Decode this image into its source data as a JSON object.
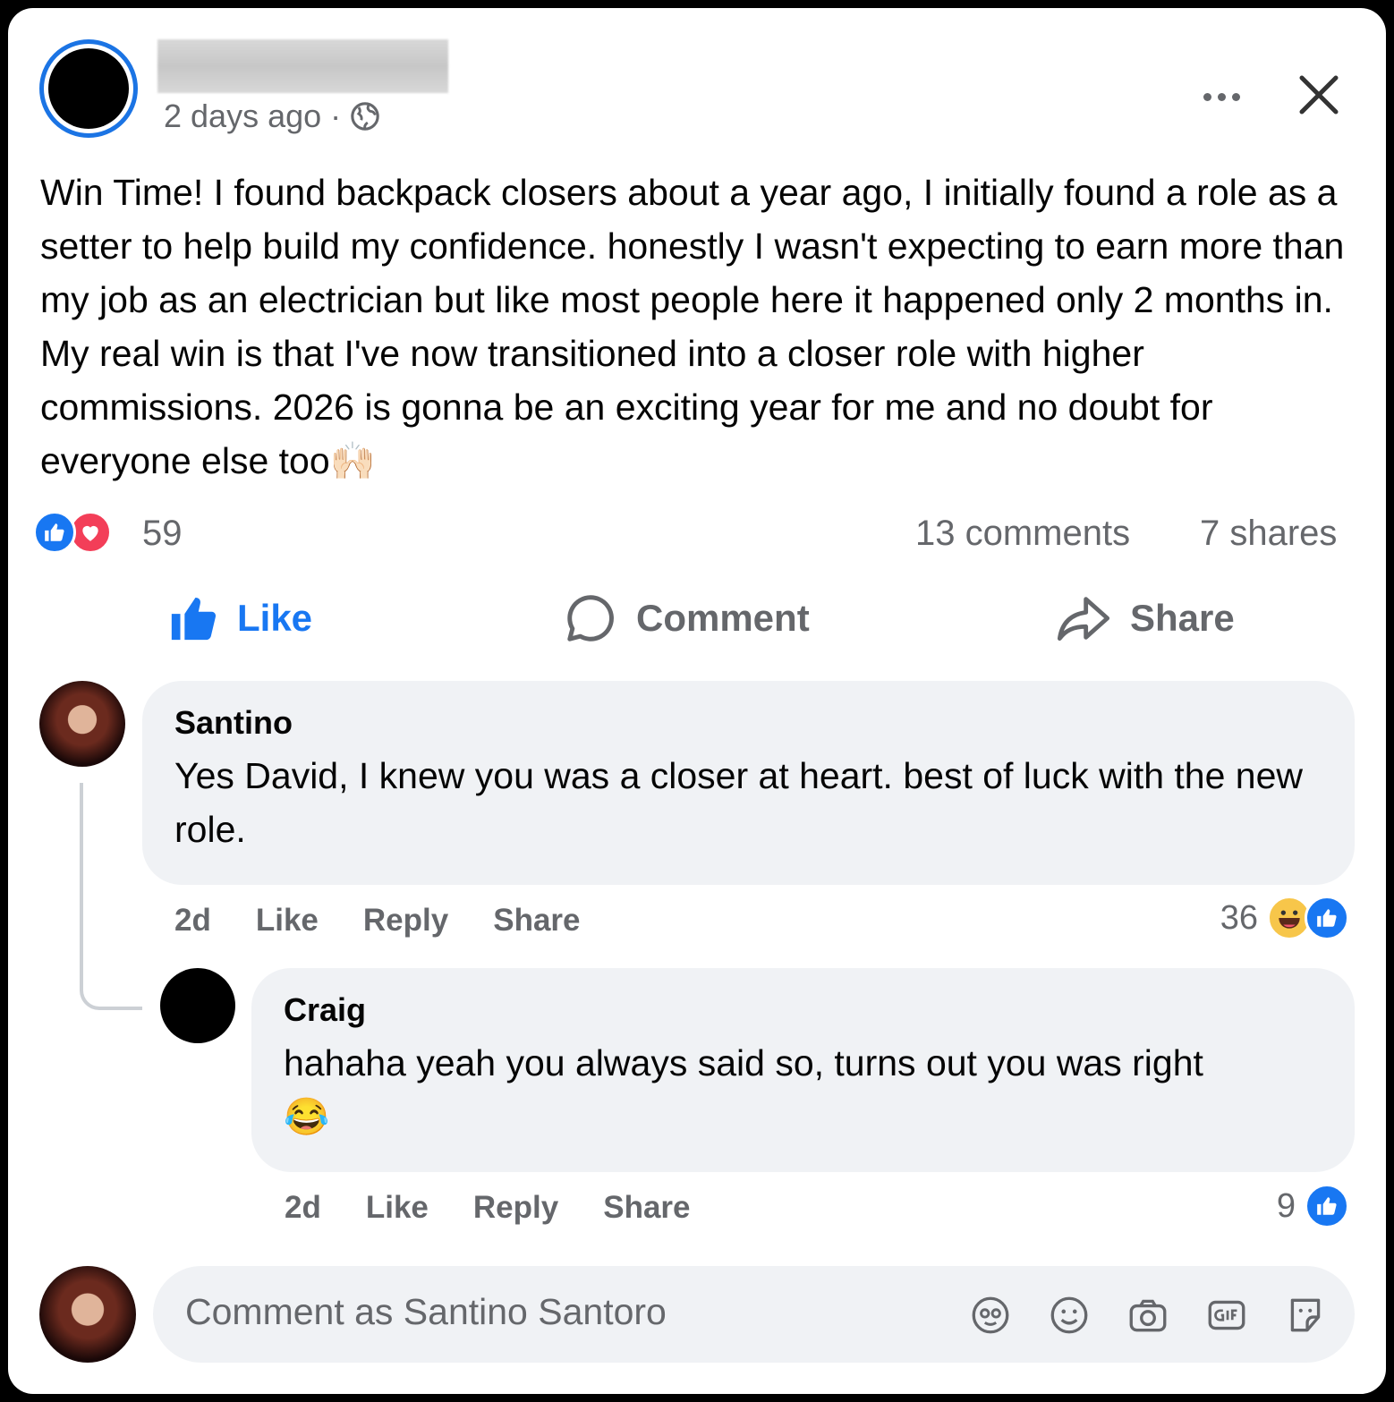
{
  "post": {
    "timestamp": "2 days ago",
    "separator": "·",
    "text": "Win Time! I found backpack closers about a year ago, I initially found a role as a setter to help build my confidence. honestly I wasn't expecting to earn more than my job as an electrician but like most people here it happened only 2 months in. My real win is that I've now transitioned into a closer role with higher commissions. 2026 is gonna be an exciting year for me and no doubt for everyone else too",
    "emoji": "🙌🏻"
  },
  "stats": {
    "reactions": "59",
    "comments": "13 comments",
    "shares": "7 shares"
  },
  "actions": {
    "like": "Like",
    "comment": "Comment",
    "share": "Share"
  },
  "comments": [
    {
      "author": "Santino",
      "text": "Yes David, I knew you was a closer at heart. best of luck with the new role.",
      "time": "2d",
      "like": "Like",
      "reply": "Reply",
      "share": "Share",
      "reactions": "36"
    },
    {
      "author": "Craig",
      "text": "hahaha yeah you always said so, turns out you was right",
      "emoji": "😂",
      "time": "2d",
      "like": "Like",
      "reply": "Reply",
      "share": "Share",
      "reactions": "9"
    }
  ],
  "composer": {
    "placeholder": "Comment as Santino Santoro"
  },
  "colors": {
    "accent": "#1877f2",
    "love": "#f33e58",
    "muted_text": "#65676b",
    "bubble": "#f0f2f5"
  },
  "icons": [
    "globe-icon",
    "more-icon",
    "close-icon",
    "like-reaction-icon",
    "love-reaction-icon",
    "thumbs-up-icon",
    "comment-bubble-icon",
    "share-arrow-icon",
    "haha-reaction-icon",
    "avatar-sticker-icon",
    "emoji-icon",
    "camera-icon",
    "gif-icon",
    "sticker-icon"
  ]
}
